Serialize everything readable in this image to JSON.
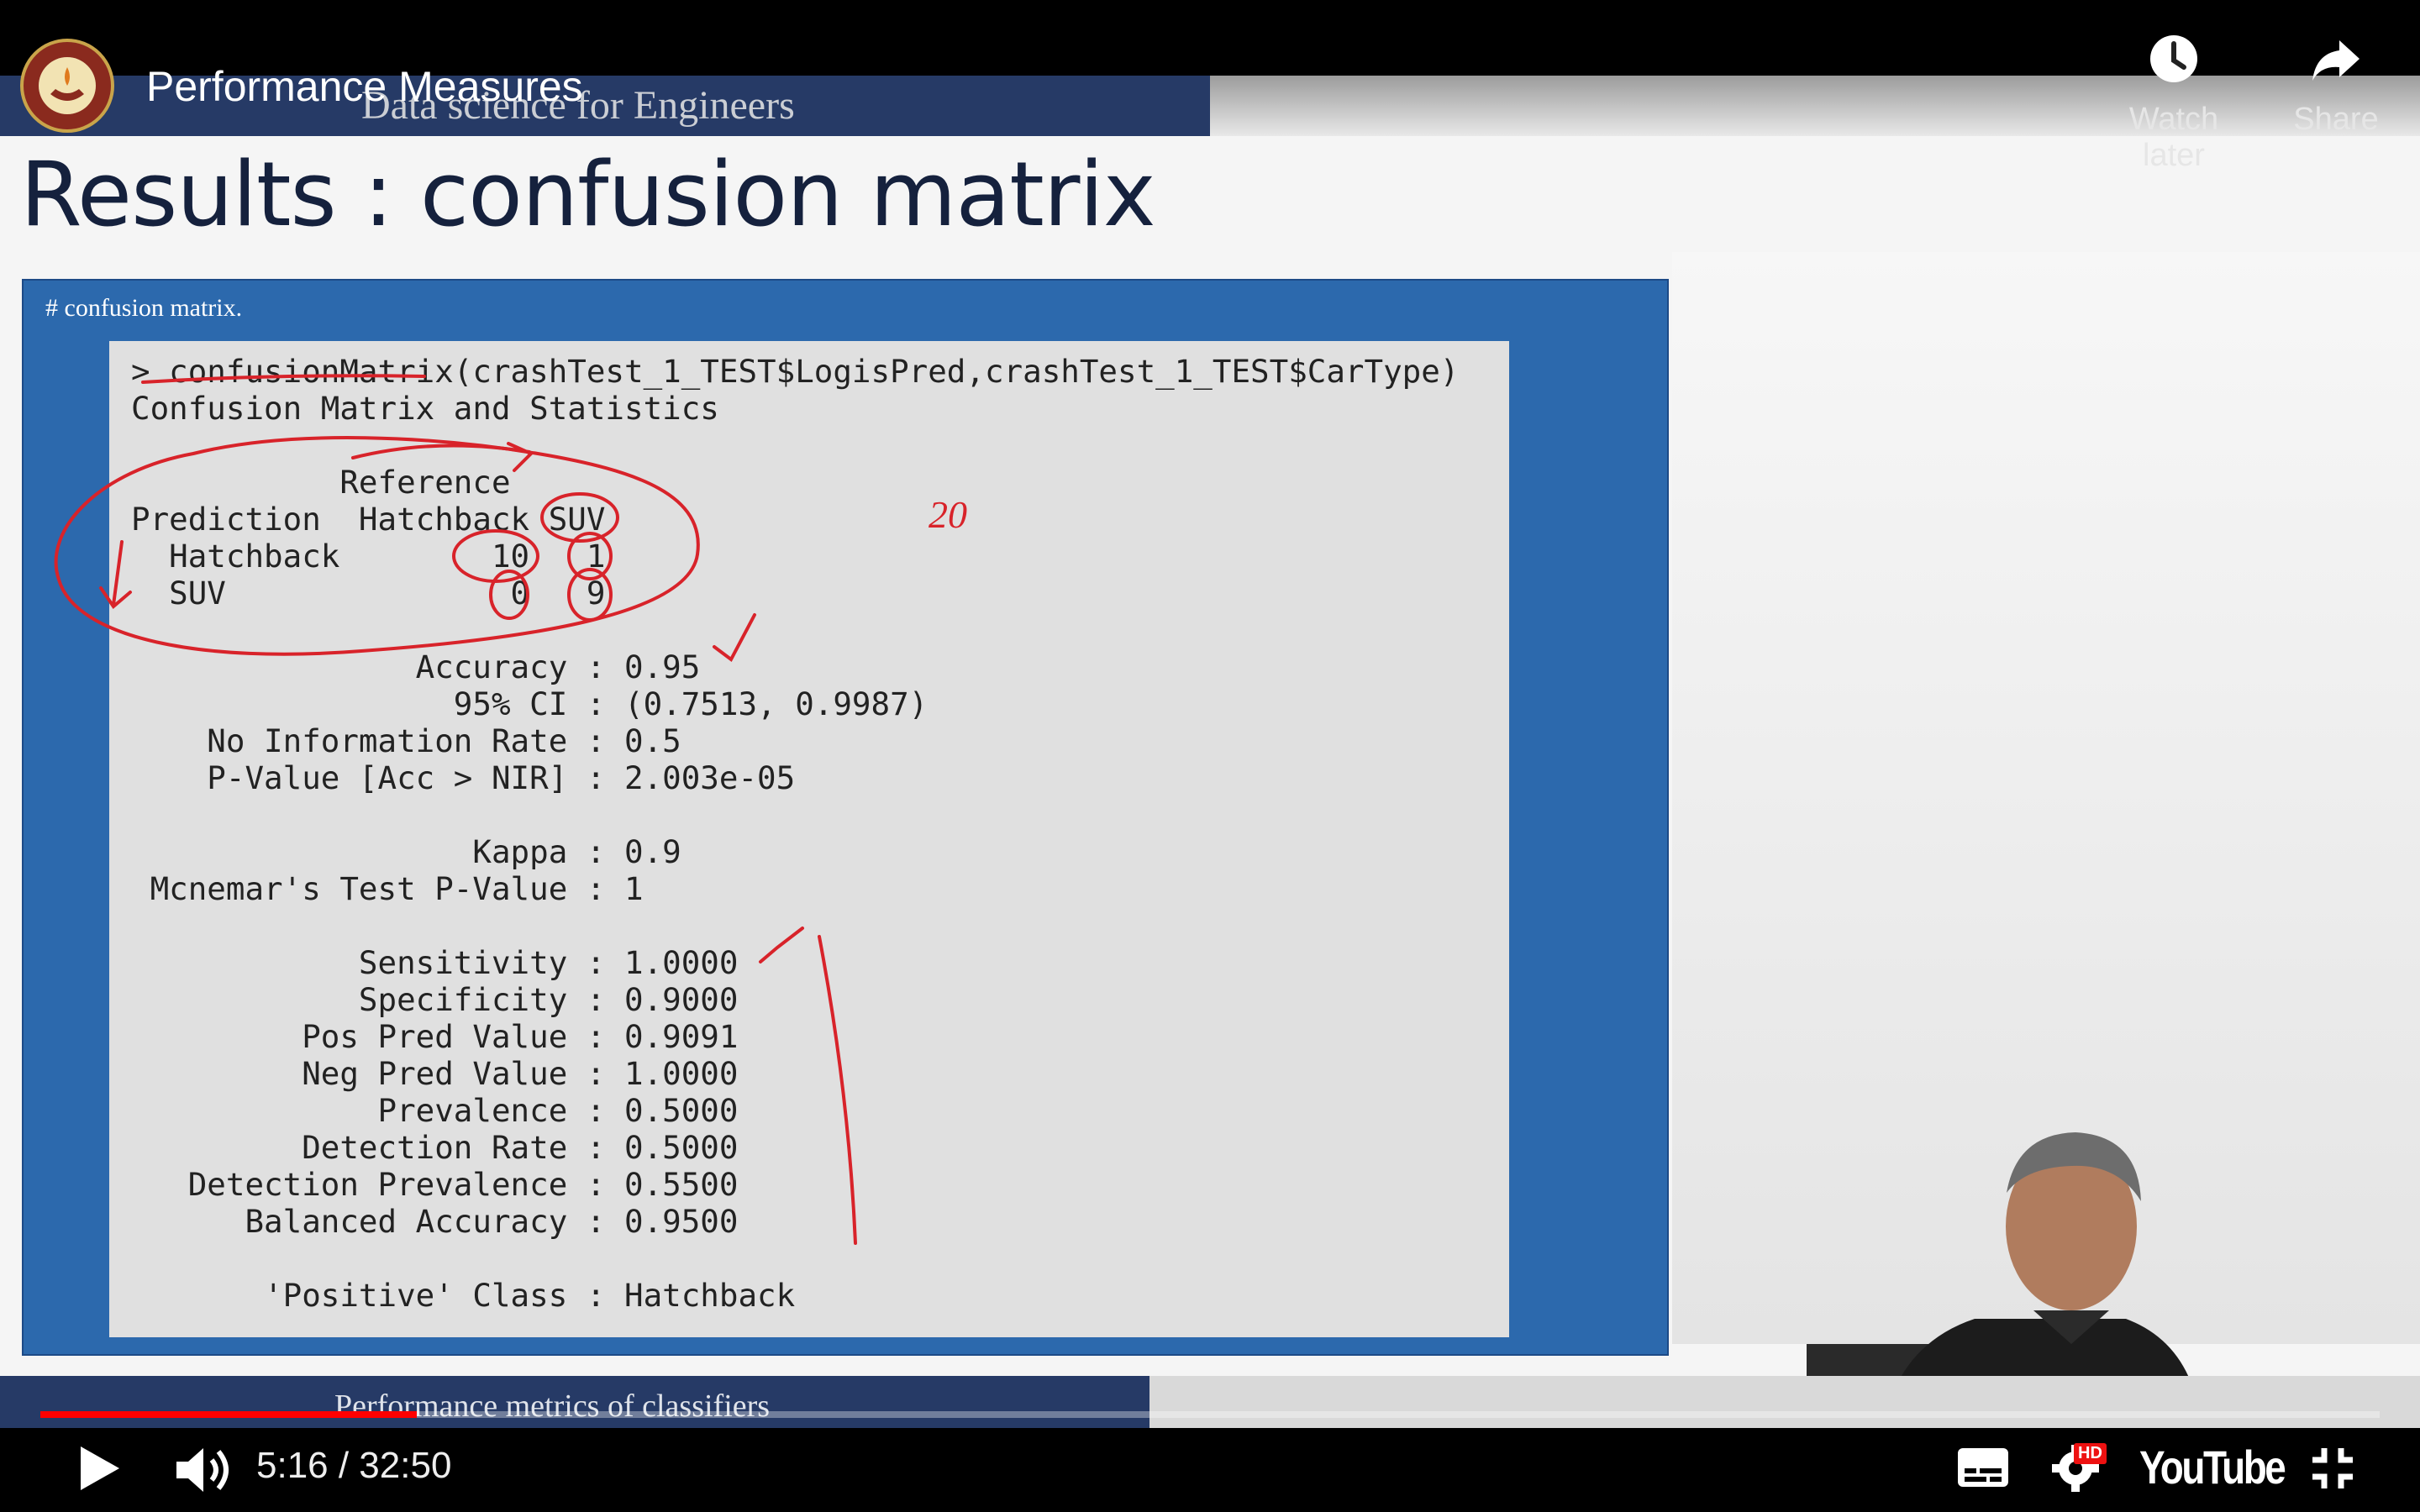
{
  "player": {
    "video_title": "Performance Measures",
    "watch_later_label": "Watch later",
    "share_label": "Share",
    "time_display": "5:16 / 32:50",
    "progress_fraction": 0.161,
    "brand": "YouTube",
    "hd_badge": "HD",
    "accent": "#ff0000"
  },
  "slide": {
    "course_title": "Data science for Engineers",
    "heading": "Results : confusion matrix",
    "panel_caption": "# confusion matrix.",
    "footer": "Performance metrics of classifiers",
    "console_lines": [
      "> confusionMatrix(crashTest_1_TEST$LogisPred,crashTest_1_TEST$CarType)",
      "Confusion Matrix and Statistics",
      "",
      "           Reference",
      "Prediction  Hatchback SUV",
      "  Hatchback        10   1",
      "  SUV               0   9",
      "",
      "               Accuracy : 0.95",
      "                 95% CI : (0.7513, 0.9987)",
      "    No Information Rate : 0.5",
      "    P-Value [Acc > NIR] : 2.003e-05",
      "",
      "                  Kappa : 0.9",
      " Mcnemar's Test P-Value : 1",
      "",
      "            Sensitivity : 1.0000",
      "            Specificity : 0.9000",
      "         Pos Pred Value : 0.9091",
      "         Neg Pred Value : 1.0000",
      "             Prevalence : 0.5000",
      "         Detection Rate : 0.5000",
      "   Detection Prevalence : 0.5500",
      "      Balanced Accuracy : 0.9500",
      "",
      "       'Positive' Class : Hatchback"
    ],
    "handwritten_note": "20"
  },
  "colors": {
    "slide_bar": "#263a66",
    "panel_blue": "#2c69ad",
    "console_bg": "#e0e0e0",
    "ink_red": "#d8232a"
  }
}
